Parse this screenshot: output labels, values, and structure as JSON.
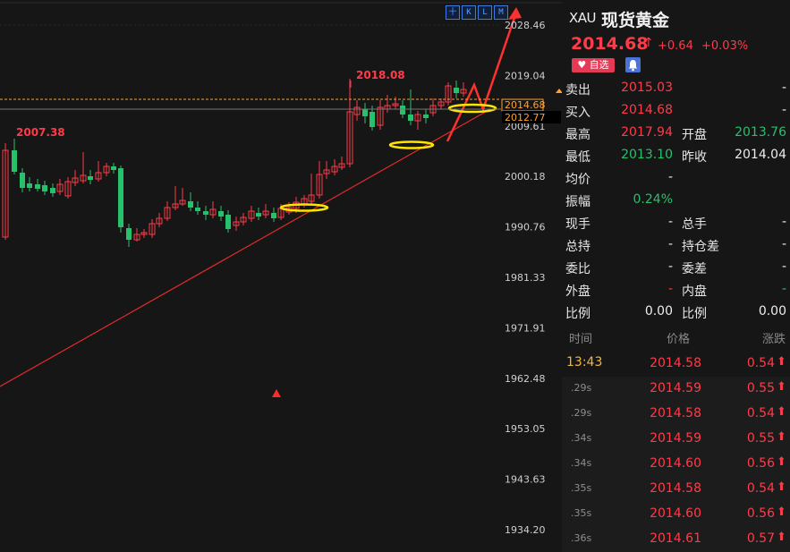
{
  "toolbar": [
    "十",
    "K",
    "L",
    "M"
  ],
  "chart": {
    "y_min": 1934.2,
    "y_max": 2028.46,
    "y_ticks": [
      "2028.46",
      "2019.04",
      "2009.61",
      "2000.18",
      "1990.76",
      "1981.33",
      "1971.91",
      "1962.48",
      "1953.05",
      "1943.63",
      "1934.20"
    ],
    "price_tag": "2014.68",
    "crosshair_tag": "2012.77",
    "high_label": "2018.08",
    "low_label": "2007.38",
    "price_line_color": "#ffa030",
    "up_color": "#ff3b4a",
    "down_color": "#25c26b"
  },
  "header": {
    "code": "XAU",
    "name": "现货黄金",
    "price": "2014.68",
    "arrow": "↑",
    "change": "+0.64",
    "change_pct": "+0.03%",
    "fav_label": "自选"
  },
  "quote": [
    {
      "l1": "卖出",
      "v1": "2015.03",
      "c1": "red",
      "l2": "",
      "v2": "-",
      "c2": "white"
    },
    {
      "l1": "买入",
      "v1": "2014.68",
      "c1": "red",
      "l2": "",
      "v2": "-",
      "c2": "white"
    },
    {
      "l1": "最高",
      "v1": "2017.94",
      "c1": "red",
      "l2": "开盘",
      "v2": "2013.76",
      "c2": "green"
    },
    {
      "l1": "最低",
      "v1": "2013.10",
      "c1": "green",
      "l2": "昨收",
      "v2": "2014.04",
      "c2": "white"
    },
    {
      "l1": "均价",
      "v1": "-",
      "c1": "white",
      "l2": "",
      "v2": "",
      "c2": "white"
    },
    {
      "l1": "振幅",
      "v1": "0.24%",
      "c1": "green",
      "l2": "",
      "v2": "",
      "c2": "white"
    },
    {
      "l1": "现手",
      "v1": "-",
      "c1": "white",
      "l2": "总手",
      "v2": "-",
      "c2": "white"
    },
    {
      "l1": "总持",
      "v1": "-",
      "c1": "white",
      "l2": "持仓差",
      "v2": "-",
      "c2": "white"
    },
    {
      "l1": "委比",
      "v1": "-",
      "c1": "white",
      "l2": "委差",
      "v2": "-",
      "c2": "white"
    },
    {
      "l1": "外盘",
      "v1": "-",
      "c1": "red",
      "l2": "内盘",
      "v2": "-",
      "c2": "green"
    },
    {
      "l1": "比例",
      "v1": "0.00",
      "c1": "white",
      "l2": "比例",
      "v2": "0.00",
      "c2": "white"
    }
  ],
  "ticks_header": {
    "time": "时间",
    "price": "价格",
    "change": "涨跌"
  },
  "ticks": [
    {
      "time": "13:43",
      "price": "2014.58",
      "change": "0.54"
    },
    {
      "time": ".29s",
      "price": "2014.59",
      "change": "0.55"
    },
    {
      "time": ".29s",
      "price": "2014.58",
      "change": "0.54"
    },
    {
      "time": ".34s",
      "price": "2014.59",
      "change": "0.55"
    },
    {
      "time": ".34s",
      "price": "2014.60",
      "change": "0.56"
    },
    {
      "time": ".35s",
      "price": "2014.58",
      "change": "0.54"
    },
    {
      "time": ".35s",
      "price": "2014.60",
      "change": "0.56"
    },
    {
      "time": ".36s",
      "price": "2014.61",
      "change": "0.57"
    }
  ]
}
